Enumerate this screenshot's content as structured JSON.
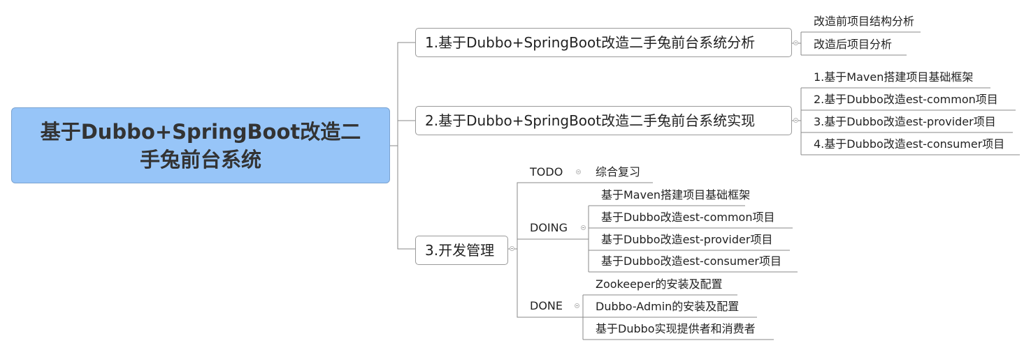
{
  "root": {
    "title": "基于Dubbo+SpringBoot改造二手兔前台系统"
  },
  "branches": [
    {
      "label": "1.基于Dubbo+SpringBoot改造二手兔前台系统分析",
      "children": [
        "改造前项目结构分析",
        "改造后项目分析"
      ]
    },
    {
      "label": "2.基于Dubbo+SpringBoot改造二手兔前台系统实现",
      "children": [
        "1.基于Maven搭建项目基础框架",
        "2.基于Dubbo改造est-common项目",
        "3.基于Dubbo改造est-provider项目",
        "4.基于Dubbo改造est-consumer项目"
      ]
    },
    {
      "label": "3.开发管理",
      "groups": [
        {
          "name": "TODO",
          "items": [
            "综合复习"
          ]
        },
        {
          "name": "DOING",
          "items": [
            "基于Maven搭建项目基础框架",
            "基于Dubbo改造est-common项目",
            "基于Dubbo改造est-provider项目",
            "基于Dubbo改造est-consumer项目"
          ]
        },
        {
          "name": "DONE",
          "items": [
            "Zookeeper的安装及配置",
            "Dubbo-Admin的安装及配置",
            "基于Dubbo实现提供者和消费者"
          ]
        }
      ]
    }
  ],
  "colors": {
    "root_fill": "#97c5f8",
    "line": "#8a8a8a",
    "box_border": "#9a9a9a"
  },
  "icons": {
    "collapse": "collapse-minus-icon"
  }
}
